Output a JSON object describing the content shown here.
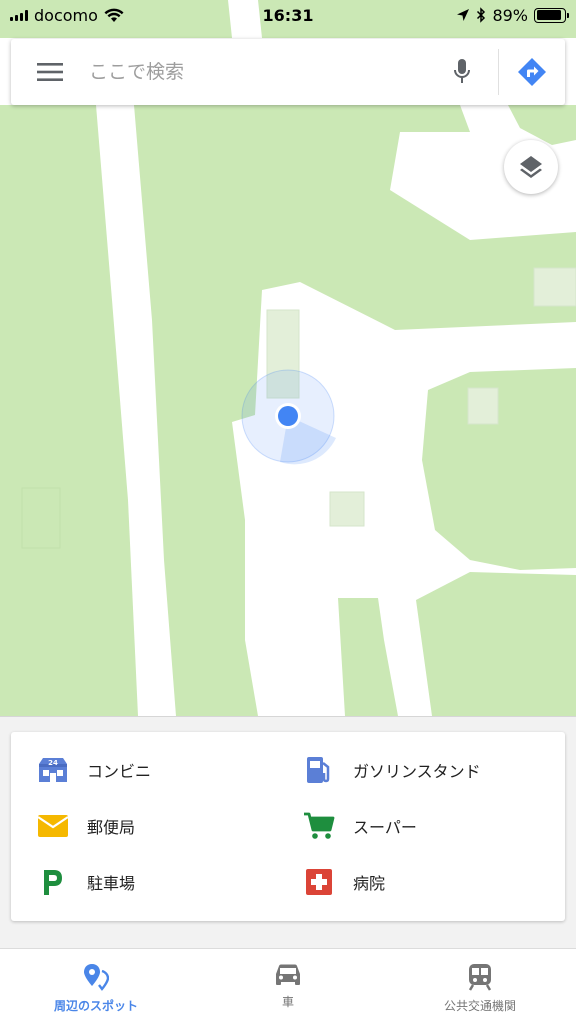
{
  "status_bar": {
    "carrier": "docomo",
    "time": "16:31",
    "battery_percent": "89%",
    "battery_level": 0.89,
    "icons": [
      "signal-bars-icon",
      "wifi-icon",
      "location-arrow-icon",
      "bluetooth-icon",
      "battery-icon"
    ]
  },
  "search": {
    "placeholder": "ここで検索",
    "value": "",
    "icons": [
      "menu-icon",
      "microphone-icon",
      "directions-icon"
    ]
  },
  "map": {
    "colors": {
      "park": "#cbe8b5",
      "road": "#ffffff",
      "building": "#e2efd9",
      "location_dot": "#4285f4"
    }
  },
  "categories": [
    {
      "label": "コンビニ",
      "icon": "convenience-store-icon",
      "color": "#5b7fd6"
    },
    {
      "label": "ガソリンスタンド",
      "icon": "gas-station-icon",
      "color": "#5b7fd6"
    },
    {
      "label": "郵便局",
      "icon": "post-office-icon",
      "color": "#f5b800"
    },
    {
      "label": "スーパー",
      "icon": "shopping-cart-icon",
      "color": "#1e8e3e"
    },
    {
      "label": "駐車場",
      "icon": "parking-icon",
      "color": "#1e8e3e"
    },
    {
      "label": "病院",
      "icon": "hospital-icon",
      "color": "#db4437"
    }
  ],
  "bottom_nav": {
    "items": [
      {
        "label": "周辺のスポット",
        "icon": "explore-pin-icon",
        "active": true
      },
      {
        "label": "車",
        "icon": "car-icon",
        "active": false
      },
      {
        "label": "公共交通機関",
        "icon": "train-icon",
        "active": false
      }
    ],
    "active_color": "#4a86e8"
  }
}
